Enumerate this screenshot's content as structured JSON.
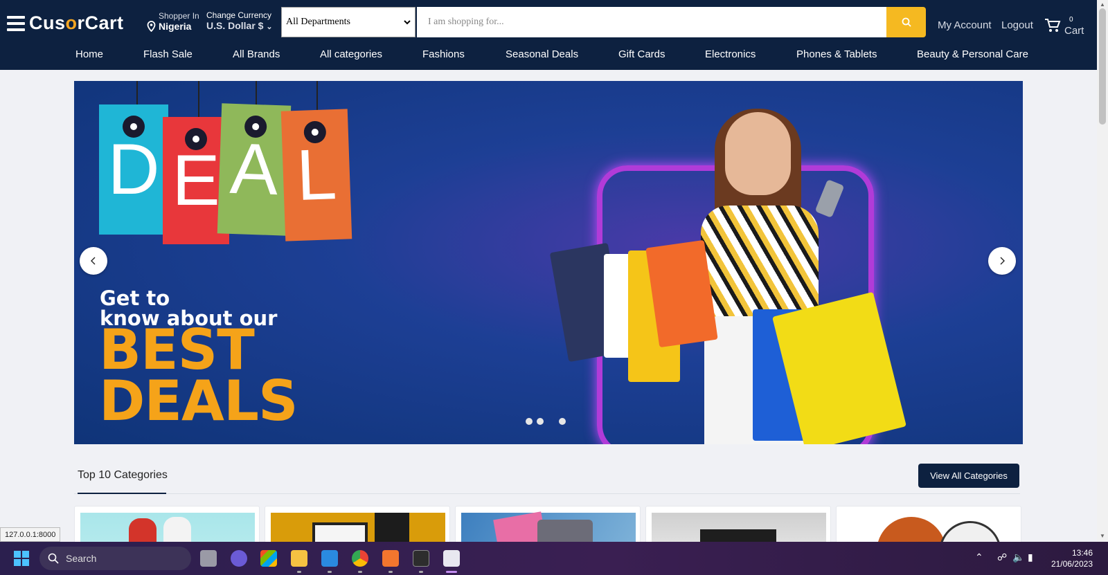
{
  "header": {
    "logo": {
      "pre": "Cus",
      "accent": "o",
      "post": "rCart"
    },
    "shopper": {
      "label": "Shopper In",
      "location": "Nigeria"
    },
    "currency": {
      "label": "Change Currency",
      "value": "U.S. Dollar $"
    },
    "department_select": {
      "value": "All Departments"
    },
    "search": {
      "placeholder": "I am shopping for...",
      "value": ""
    },
    "my_account": "My Account",
    "logout": "Logout",
    "cart": {
      "count": "0",
      "label": "Cart"
    }
  },
  "nav": {
    "items": [
      "Home",
      "Flash Sale",
      "All Brands",
      "All categories",
      "Fashions",
      "Seasonal Deals",
      "Gift Cards",
      "Electronics",
      "Phones & Tablets",
      "Beauty & Personal Care"
    ]
  },
  "hero": {
    "tags": [
      "D",
      "E",
      "A",
      "L"
    ],
    "tag_colors": [
      "#1fb6d6",
      "#e8373b",
      "#8fb85a",
      "#e96f34"
    ],
    "line1": "Get to",
    "line2": "know about our",
    "line3": "BEST",
    "line4": "DEALS",
    "active_slide": 2,
    "slide_count": 4
  },
  "categories": {
    "title": "Top 10 Categories",
    "view_all": "View All Categories",
    "cards": [
      "fashion-category-image",
      "computers-category-image",
      "tablets-category-image",
      "desktops-category-image",
      "sports-category-image"
    ]
  },
  "status_url": "127.0.0.1:8000",
  "taskbar": {
    "search": "Search",
    "time": "13:46",
    "date": "21/06/2023"
  },
  "colors": {
    "brand_navy": "#0d2140",
    "accent_yellow": "#f5b921",
    "deal_orange": "#f5a319"
  }
}
